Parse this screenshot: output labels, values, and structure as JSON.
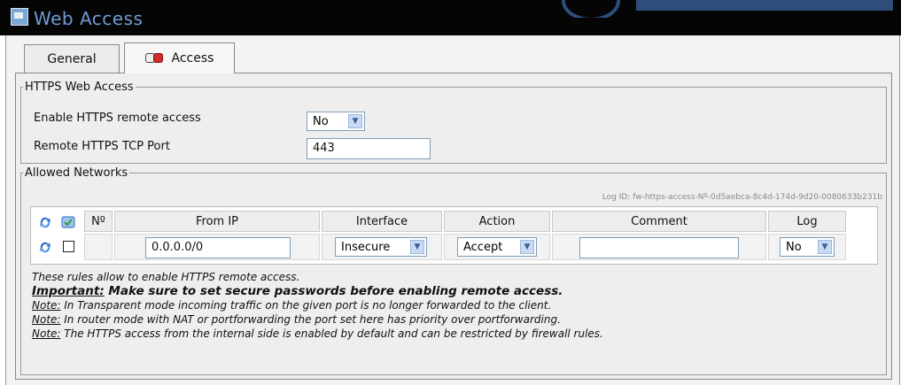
{
  "window": {
    "title": "Web Access"
  },
  "tabs": [
    {
      "label": "General"
    },
    {
      "label": "Access"
    }
  ],
  "https_section": {
    "legend": "HTTPS Web Access",
    "enable_label": "Enable HTTPS remote access",
    "enable_value": "No",
    "port_label": "Remote HTTPS TCP Port",
    "port_value": "443"
  },
  "networks": {
    "legend": "Allowed Networks",
    "log_id": "Log ID: fw-https-access-Nº-0d5aebca-8c4d-174d-9d20-0080633b231b",
    "columns": [
      "Nº",
      "From IP",
      "Interface",
      "Action",
      "Comment",
      "Log"
    ],
    "row": {
      "from_ip": "0.0.0.0/0",
      "interface": "Insecure",
      "action": "Accept",
      "comment": "",
      "log": "No"
    }
  },
  "notes": {
    "line1": "These rules allow to enable HTTPS remote access.",
    "important_label": "Important:",
    "important_text": " Make sure to set secure passwords before enabling remote access.",
    "note_label": "Note:",
    "note1": " In Transparent mode incoming traffic on the given port is no longer forwarded to the client.",
    "note2": " In router mode with NAT or portforwarding the port set here has priority over portforwarding.",
    "note3": " The HTTPS access from the internal side is enabled by default and can be restricted by firewall rules."
  },
  "icons": {
    "refresh": "refresh-icon",
    "add": "add-icon"
  }
}
